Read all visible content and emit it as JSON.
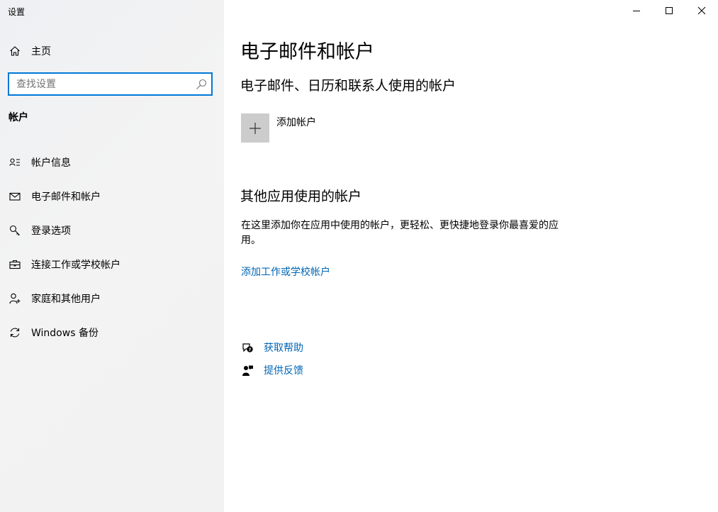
{
  "window": {
    "title": "设置",
    "controls": [
      "minimize",
      "maximize",
      "close"
    ]
  },
  "sidebar": {
    "home": {
      "label": "主页",
      "icon": "home-icon"
    },
    "search": {
      "placeholder": "查找设置",
      "value": ""
    },
    "section_title": "帐户",
    "items": [
      {
        "label": "帐户信息",
        "icon": "person-card-icon"
      },
      {
        "label": "电子邮件和帐户",
        "icon": "mail-icon"
      },
      {
        "label": "登录选项",
        "icon": "key-icon"
      },
      {
        "label": "连接工作或学校帐户",
        "icon": "briefcase-icon"
      },
      {
        "label": "家庭和其他用户",
        "icon": "person-add-icon"
      },
      {
        "label": "Windows 备份",
        "icon": "sync-icon"
      }
    ]
  },
  "main": {
    "title": "电子邮件和帐户",
    "email_section_title": "电子邮件、日历和联系人使用的帐户",
    "add_account_label": "添加帐户",
    "other_section_title": "其他应用使用的帐户",
    "other_description": "在这里添加你在应用中使用的帐户，更轻松、更快捷地登录你最喜爱的应用。",
    "add_work_link": "添加工作或学校帐户",
    "help_links": [
      {
        "label": "获取帮助",
        "icon": "help-chat-icon"
      },
      {
        "label": "提供反馈",
        "icon": "feedback-icon"
      }
    ]
  },
  "colors": {
    "accent": "#0078d7",
    "link": "#0066b4",
    "sidebar_bg": "#f2f2f2",
    "tile_bg": "#cccccc"
  }
}
